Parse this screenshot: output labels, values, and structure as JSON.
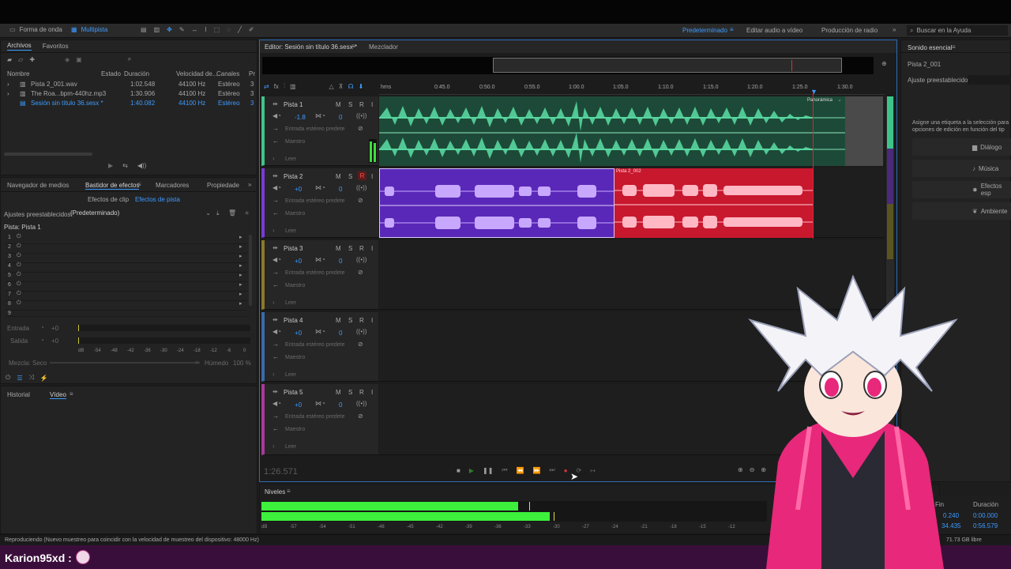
{
  "toolbar": {
    "waveform_label": "Forma de onda",
    "multitrack_label": "Multipista",
    "workspaces": [
      "Predeterminado",
      "Editar audio a vídeo",
      "Producción de radio"
    ],
    "search_placeholder": "Buscar en la Ayuda"
  },
  "files_panel": {
    "tabs": [
      "Archivos",
      "Favoritos"
    ],
    "columns": [
      "Nombre",
      "Estado",
      "Duración",
      "Velocidad de...",
      "Canales",
      "Pr"
    ],
    "files": [
      {
        "name": "Pista 2_001.wav",
        "duration": "1:02.548",
        "rate": "44100 Hz",
        "channels": "Estéreo",
        "pr": "3"
      },
      {
        "name": "The Roa...bpm-440hz.mp3",
        "duration": "1:30.906",
        "rate": "44100 Hz",
        "channels": "Estéreo",
        "pr": "3"
      },
      {
        "name": "Sesión sin título 36.sesx *",
        "duration": "1:40.082",
        "rate": "44100 Hz",
        "channels": "Estéreo",
        "pr": "3"
      }
    ]
  },
  "effects_panel": {
    "tabs": [
      "Navegador de medios",
      "Bastidor de efectos",
      "Marcadores",
      "Propiedade"
    ],
    "subtabs": [
      "Efectos de clip",
      "Efectos de pista"
    ],
    "presets_label": "Ajustes preestablecidos:",
    "presets_value": "(Predeterminado)",
    "track_label": "Pista: Pista 1",
    "slots": [
      "1",
      "2",
      "3",
      "4",
      "5",
      "6",
      "7",
      "8",
      "9"
    ],
    "input_label": "Entrada",
    "output_label": "Salida",
    "input_value": "+0",
    "output_value": "+0",
    "mix_label": "Mezcla:",
    "mix_dry": "Seco",
    "mix_wet": "Húmedo",
    "mix_pct": "100 %",
    "meter_ticks": [
      "dB",
      "-54",
      "-48",
      "-42",
      "-36",
      "-30",
      "-24",
      "-18",
      "-12",
      "-6",
      "0"
    ]
  },
  "history_panel": {
    "tabs": [
      "Historial",
      "Vídeo"
    ]
  },
  "editor": {
    "tabs": [
      "Editor: Sesión sin título 36.sesx *",
      "Mezclador"
    ],
    "time_ruler": [
      "hms",
      "0:45.0",
      "0:50.0",
      "0:55.0",
      "1:00.0",
      "1:05.0",
      "1:10.0",
      "1:15.0",
      "1:20.0",
      "1:25.0",
      "1:30.0"
    ],
    "pan_label": "Panorámica",
    "current_time": "1:26.571",
    "tracks": [
      {
        "name": "Pista 1",
        "vol": "-1.8",
        "pan": "0",
        "input": "Entrada estéreo predete",
        "mode": "Maestro",
        "read": "Leer",
        "color": "#3ec48a"
      },
      {
        "name": "Pista 2",
        "vol": "+0",
        "pan": "0",
        "input": "Entrada estéreo predete",
        "mode": "Maestro",
        "read": "Leer",
        "color": "#7a3bd6"
      },
      {
        "name": "Pista 3",
        "vol": "+0",
        "pan": "0",
        "input": "Entrada estéreo predete",
        "mode": "Maestro",
        "read": "Leer",
        "color": "#8a7a2a"
      },
      {
        "name": "Pista 4",
        "vol": "+0",
        "pan": "0",
        "input": "Entrada estéreo predete",
        "mode": "Maestro",
        "read": "Leer",
        "color": "#3a6aa8"
      },
      {
        "name": "Pista 5",
        "vol": "+0",
        "pan": "0",
        "input": "Entrada estéreo predete",
        "mode": "Maestro",
        "read": "Leer",
        "color": "#a83a9a"
      }
    ],
    "clip_label": "Pista 2_002"
  },
  "essential_sound": {
    "title": "Sonido esencial",
    "clip_name": "Pista 2_001",
    "presets_label": "Ajuste preestablecido:",
    "hint": "Asigne una etiqueta a la selección para opciones de edición en función del tip",
    "buttons": [
      "Diálogo",
      "Música",
      "Efectos esp",
      "Ambiente"
    ]
  },
  "levels": {
    "title": "Niveles",
    "ticks": [
      "dB",
      "-57",
      "-54",
      "-51",
      "-48",
      "-45",
      "-42",
      "-39",
      "-36",
      "-33",
      "-30",
      "-27",
      "-24",
      "-21",
      "-18",
      "-15",
      "-12"
    ],
    "left_level_pct": 0.56,
    "right_level_pct": 0.63
  },
  "selection_panel": {
    "col_end": "Fin",
    "col_duration": "Duración",
    "rows": [
      [
        "0.240",
        "0:00.000"
      ],
      [
        "34.435",
        "0:56.579"
      ]
    ]
  },
  "status": {
    "message": "Reproduciendo (Nuevo muestreo para coincidir con la velocidad de muestreo del dispositivo: 48000 Hz)",
    "disk": "71.73 GB libre"
  },
  "chat": {
    "user": "Karion95xd :"
  }
}
